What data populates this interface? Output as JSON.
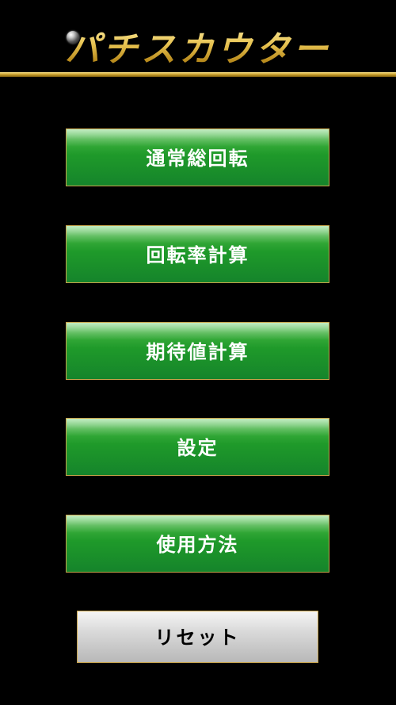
{
  "app": {
    "title": "パチスカウター"
  },
  "menu": {
    "items": [
      {
        "label": "通常総回転"
      },
      {
        "label": "回転率計算"
      },
      {
        "label": "期待値計算"
      },
      {
        "label": "設定"
      },
      {
        "label": "使用方法"
      }
    ]
  },
  "reset": {
    "label": "リセット"
  },
  "icons": {
    "logo_ball": "pachinko-ball-icon"
  },
  "colors": {
    "background": "#000000",
    "gold": "#d9b84a",
    "menu_button": "#1f9a2a",
    "reset_button": "#d0d0d0"
  }
}
